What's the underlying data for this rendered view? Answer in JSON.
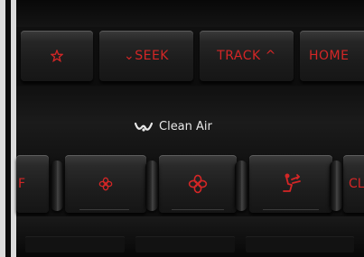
{
  "top_row": {
    "home_icon": "star-icon",
    "seek_label": "⌄SEEK",
    "track_label": "TRACK ^",
    "home_label": "HOME"
  },
  "clean_air": {
    "label": "Clean Air",
    "icon": "clean-air-icon"
  },
  "bottom_row": {
    "left_partial_label": "F",
    "fan_low_icon": "fan-low-icon",
    "fan_high_icon": "fan-high-icon",
    "seat_airflow_icon": "seat-airflow-icon",
    "right_partial_label": "CL"
  },
  "colors": {
    "accent_red": "#d42626",
    "panel_black": "#0d0d0d",
    "label_white": "#e8e8e8"
  }
}
